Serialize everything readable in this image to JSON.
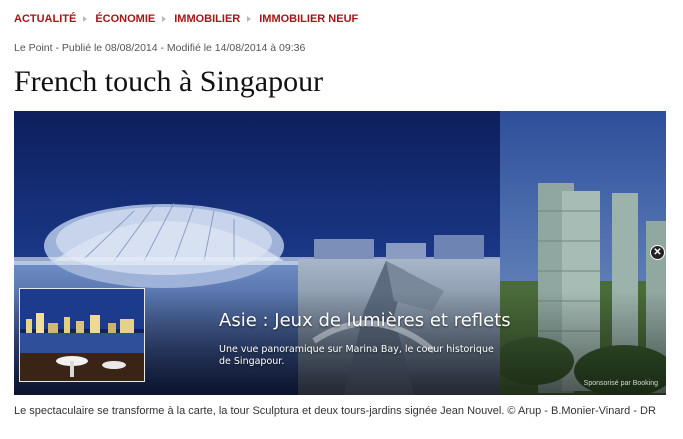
{
  "breadcrumb": {
    "items": [
      {
        "label": "ACTUALITÉ"
      },
      {
        "label": "ÉCONOMIE"
      },
      {
        "label": "IMMOBILIER"
      },
      {
        "label": "IMMOBILIER NEUF"
      }
    ]
  },
  "meta": {
    "byline": "Le Point - Publié le 08/08/2014 - Modifié le 14/08/2014 à 09:36"
  },
  "article": {
    "title": "French touch à Singapour",
    "caption": "Le spectaculaire se transforme à la carte, la tour Sculptura et deux tours-jardins signée Jean Nouvel. © Arup - B.Monier-Vinard - DR"
  },
  "ad": {
    "title": "Asie : Jeux de lumières et reflets",
    "description": "Une vue panoramique sur Marina Bay, le coeur historique de Singapour.",
    "sponsor": "Sponsorisé par Booking",
    "close_icon": "close-icon"
  },
  "colors": {
    "breadcrumb": "#a3171a",
    "title": "#111111",
    "sky": "#142a6e"
  }
}
